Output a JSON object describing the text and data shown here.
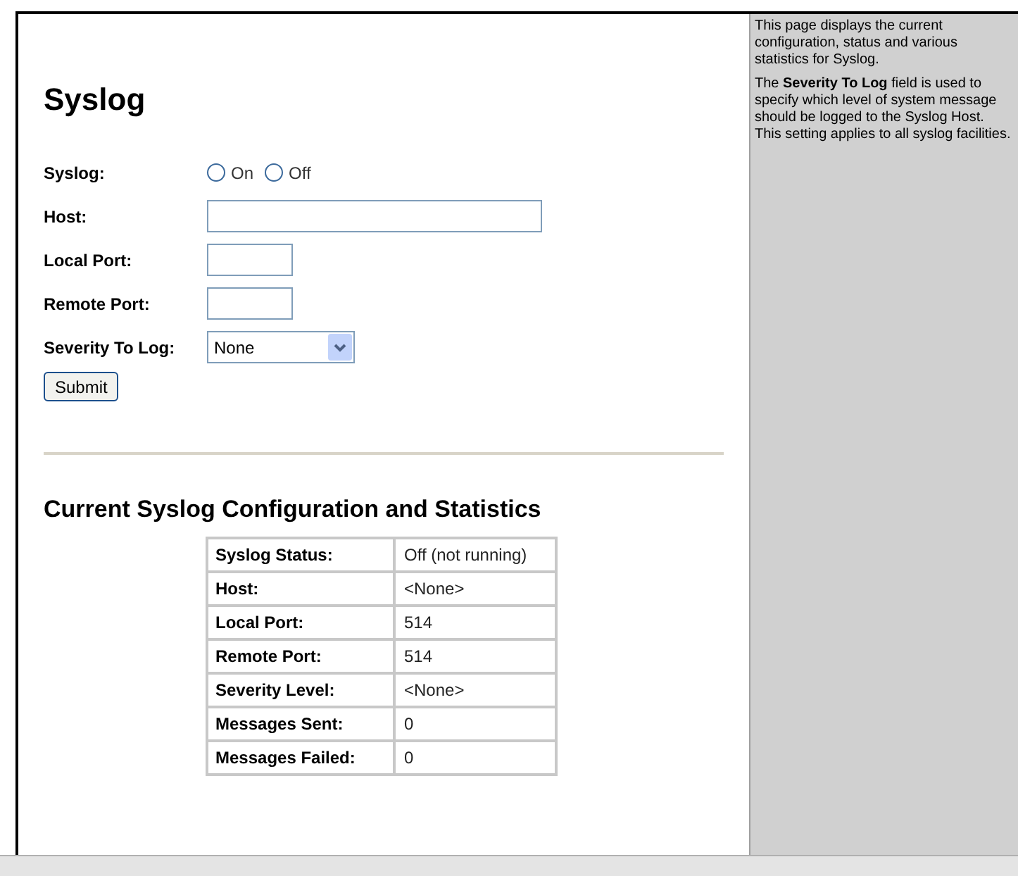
{
  "title": "Syslog",
  "form": {
    "syslog_label": "Syslog:",
    "options": [
      {
        "label": "On",
        "selected": false
      },
      {
        "label": "Off",
        "selected": false
      }
    ],
    "host_label": "Host:",
    "local_port_label": "Local Port:",
    "remote_port_label": "Remote Port:",
    "severity_label": "Severity To Log:",
    "severity_value": "None",
    "submit": "Submit"
  },
  "stats": {
    "title": "Current Syslog Configuration and Statistics",
    "rows": [
      {
        "label": "Syslog Status:",
        "value": "Off (not running)"
      },
      {
        "label": "Host:",
        "value": "<None>"
      },
      {
        "label": "Local Port:",
        "value": "514"
      },
      {
        "label": "Remote Port:",
        "value": "514"
      },
      {
        "label": "Severity Level:",
        "value": "<None>"
      },
      {
        "label": "Messages Sent:",
        "value": "0"
      },
      {
        "label": "Messages Failed:",
        "value": "0"
      }
    ]
  },
  "help": [
    "This page displays the current configuration, status and various statistics for Syslog.",
    "The **Severity To Log** field is used to specify which level of system message should be logged to the Syslog Host. This setting applies to all syslog facilities."
  ]
}
